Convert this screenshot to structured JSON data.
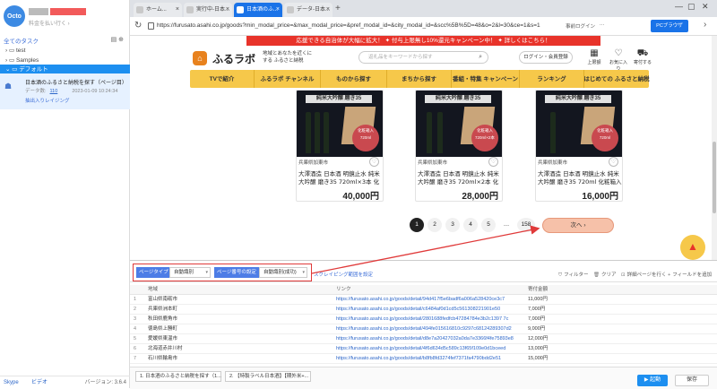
{
  "sidebar": {
    "logo": "Octo",
    "user_sub": "料金を払い行く ›",
    "section_title": "全てのタスク",
    "items": [
      {
        "label": "test"
      },
      {
        "label": "Samples"
      },
      {
        "label": "デフォルト"
      }
    ],
    "task": {
      "title": "日本酒のふるさと納税を探す（ページ目）",
      "count_label": "データ数:",
      "count": "110",
      "timestamp": "2023-01-09 10:24:34",
      "status": "抽出入りレイジング"
    },
    "footer": {
      "skype": "Skype",
      "feedback": "ビデオ",
      "version": "バージョン: 3.6.4"
    }
  },
  "browser": {
    "tabs": [
      {
        "label": "ホーム..."
      },
      {
        "label": "実行中-日本..."
      },
      {
        "label": "日本酒のふ..."
      },
      {
        "label": "データ-日本..."
      }
    ],
    "url": "https://furusato.asahi.co.jp/goods?min_modal_price=&max_modal_price=&pref_modal_id=&city_modal_id=&scc%5B%5D=48&o=2&l=30&ce=1&s=1",
    "btn_login": "事前ログイン",
    "btn_other": "",
    "btn_pc": "PCブラウザ"
  },
  "site": {
    "banner": "応援できる自治体が大幅に拡大！ ✦ 付与上限無し10%還元キャンペーン中！ ✦ 詳しくはこちら！",
    "name": "ふるラボ",
    "tagline": "地域とあなたを近くにする ふるさと納税",
    "search_placeholder": "返礼品をキーワードから探す",
    "login": "ログイン・会員登録",
    "header_icons": [
      {
        "label": "上限額",
        "icon": "calculator-icon"
      },
      {
        "label": "お気に入り",
        "icon": "heart-icon"
      },
      {
        "label": "寄付する",
        "icon": "cart-icon"
      }
    ],
    "nav": [
      {
        "label": "TVで紹介"
      },
      {
        "label": "ふるラボ チャンネル"
      },
      {
        "label": "ものから探す"
      },
      {
        "label": "まちから探す"
      },
      {
        "label": "番組・特集 キャンペーン"
      },
      {
        "label": "ランキング"
      },
      {
        "label": "はじめての ふるさと納税"
      }
    ],
    "products": [
      {
        "label": "純米大吟醸 磨き35",
        "badge": "化粧箱入 720ml",
        "location": "兵庫県加東市",
        "name": "大澤酒造 日本酒 明鏡止水 純米大吟醸 磨き35 720ml×3本 化粧箱入[…",
        "price": "40,000円"
      },
      {
        "label": "純米大吟醸 磨き35",
        "badge": "化粧箱入 720ml×2本",
        "location": "兵庫県加東市",
        "name": "大澤酒造 日本酒 明鏡止水 純米大吟醸 磨き35 720ml×2本 化粧箱入[…",
        "price": "28,000円"
      },
      {
        "label": "純米大吟醸 磨き35",
        "badge": "化粧箱入 720ml",
        "location": "兵庫県加東市",
        "name": "大澤酒造 日本酒 明鏡止水 純米大吟醸 磨き35 720ml 化粧箱入[ 酒 お…",
        "price": "16,000円"
      }
    ],
    "pages": [
      "1",
      "2",
      "3",
      "4",
      "5",
      "…",
      "158"
    ],
    "next_label": "次へ",
    "scroll_top": "▲"
  },
  "panel": {
    "page_type_label": "ページタイプ",
    "page_type_value": "自動識別",
    "page_num_label": "ページ番号の設定",
    "page_num_value": "自動識別(成功)",
    "link_label": "スクレイピング範囲を設定",
    "buttons": [
      {
        "label": "フィルター",
        "icon": "filter-icon"
      },
      {
        "label": "クリア",
        "icon": "trash-icon"
      },
      {
        "label": "詳細ページを行く",
        "icon": "link-icon"
      },
      {
        "label": "フィールドを追加",
        "icon": "plus-icon"
      }
    ],
    "columns": [
      "",
      "地域",
      "リンク",
      "寄付金額"
    ],
    "rows": [
      [
        "1",
        "富山県南砺市",
        "https://furusato.asahi.co.jp/goods/detail/94d417f5e6badf6a006a528420ce3c7",
        "11,000円"
      ],
      [
        "2",
        "兵庫県洲本町",
        "https://furusato.asahi.co.jp/goods/detail/c6484af0d1cd5c561308221901e50",
        "7,000円"
      ],
      [
        "3",
        "秋田県鹿角市",
        "https://furusato.asahi.co.jp/goods/detail/2801688fedfcb47284784e3b2c1397 7c",
        "7,000円"
      ],
      [
        "4",
        "徳島県上勝町",
        "https://furusato.asahi.co.jp/goods/detail/494fe015616810c9297c68124289307d2",
        "9,000円"
      ],
      [
        "5",
        "愛媛県東温市",
        "https://furusato.asahi.co.jp/goods/detail/d8e7a20427032a0da7e3366f4fe75893e8",
        "12,000円"
      ],
      [
        "6",
        "北海道赤井川村",
        "https://furusato.asahi.co.jp/goods/detail/4f6d634d5c589c13f65f109e0d1bceed",
        "13,000円"
      ],
      [
        "7",
        "石川県輪島市",
        "https://furusato.asahi.co.jp/goods/detail/b8fb8fd3274fef7371fa4790bdd2e51",
        "15,000円"
      ]
    ],
    "bottom_tabs": [
      {
        "label": "1. 日本酒のふるさと納税を探す（1..."
      },
      {
        "label": "2. 【特製ラベル日本酒】【期外米+..."
      }
    ],
    "run_label": "▶ 起動",
    "save_label": "保存"
  },
  "colors": {
    "accent": "#1d8ff0",
    "highlight": "#e03a3a",
    "nav": "#f6c84a"
  }
}
